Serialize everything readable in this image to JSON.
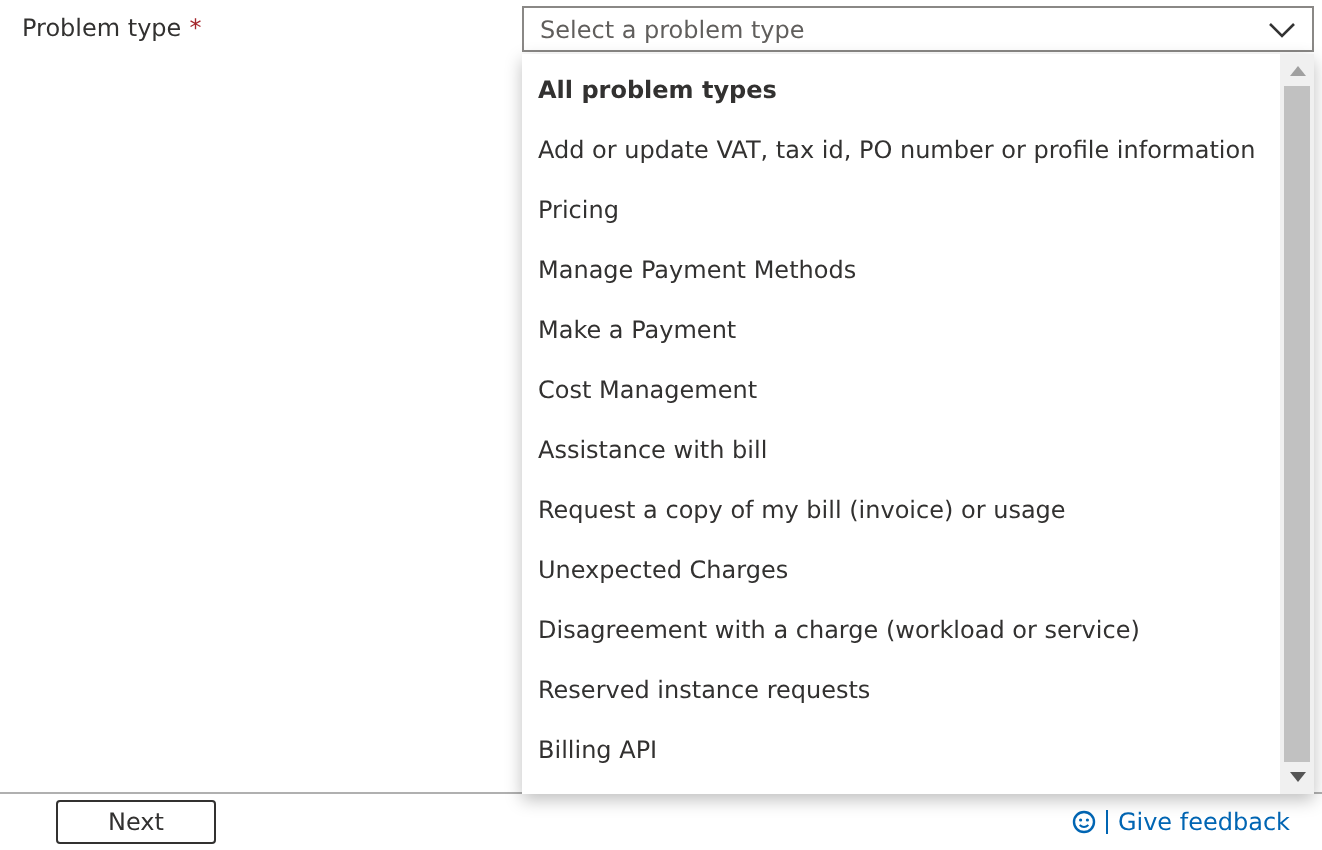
{
  "field": {
    "label": "Problem type",
    "required_mark": "*",
    "placeholder": "Select a problem type",
    "expanded": true
  },
  "options": [
    {
      "label": "All problem types",
      "kind": "header"
    },
    {
      "label": "Add or update VAT, tax id, PO number or profile information",
      "kind": "option"
    },
    {
      "label": "Pricing",
      "kind": "option"
    },
    {
      "label": "Manage Payment Methods",
      "kind": "option"
    },
    {
      "label": "Make a Payment",
      "kind": "option"
    },
    {
      "label": "Cost Management",
      "kind": "option"
    },
    {
      "label": "Assistance with bill",
      "kind": "option"
    },
    {
      "label": "Request a copy of my bill (invoice) or usage",
      "kind": "option"
    },
    {
      "label": "Unexpected Charges",
      "kind": "option"
    },
    {
      "label": "Disagreement with a charge (workload or service)",
      "kind": "option"
    },
    {
      "label": "Reserved instance requests",
      "kind": "option"
    },
    {
      "label": "Billing API",
      "kind": "option"
    }
  ],
  "footer": {
    "next_button": "Next",
    "feedback_link": "Give feedback"
  }
}
